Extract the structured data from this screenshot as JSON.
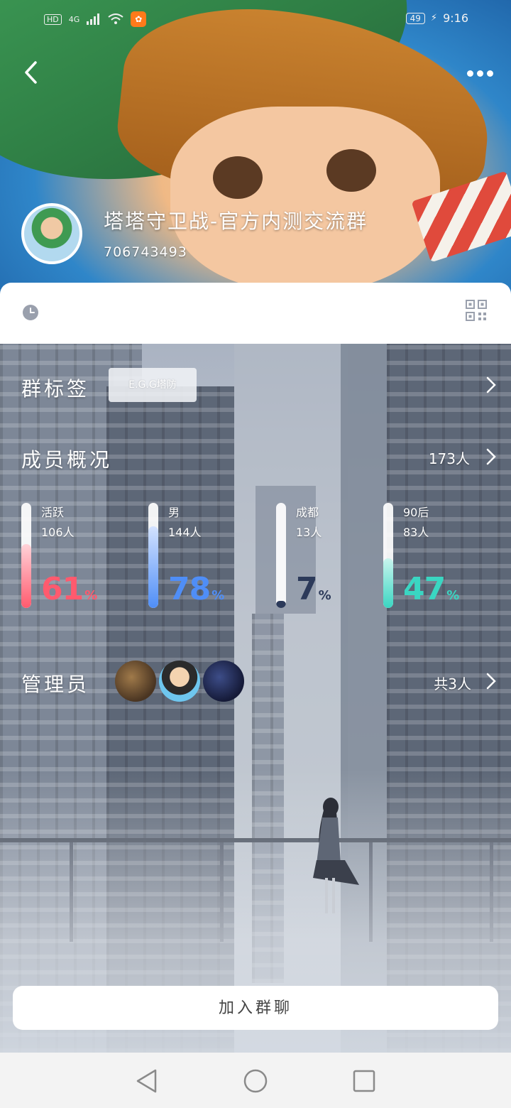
{
  "status_bar": {
    "network_hd": "HD",
    "network_type": "4G",
    "battery": "49",
    "time": "9:16"
  },
  "header": {
    "group_name": "塔塔守卫战-官方内测交流群",
    "group_id": "706743493"
  },
  "group_tags": {
    "title": "群标签",
    "tag": "E.G.G塔防"
  },
  "members": {
    "title": "成员概况",
    "total": "173人",
    "stats": [
      {
        "label": "活跃",
        "count": "106人",
        "percent": "61",
        "unit": "%",
        "color": "#ff5a6e"
      },
      {
        "label": "男",
        "count": "144人",
        "percent": "78",
        "unit": "%",
        "color": "#4f8ef7"
      },
      {
        "label": "成都",
        "count": "13人",
        "percent": "7",
        "unit": "%",
        "color": "#2c3a5a"
      },
      {
        "label": "90后",
        "count": "83人",
        "percent": "47",
        "unit": "%",
        "color": "#3ad6c2"
      }
    ]
  },
  "admins": {
    "title": "管理员",
    "total": "共3人"
  },
  "join_button": "加入群聊"
}
